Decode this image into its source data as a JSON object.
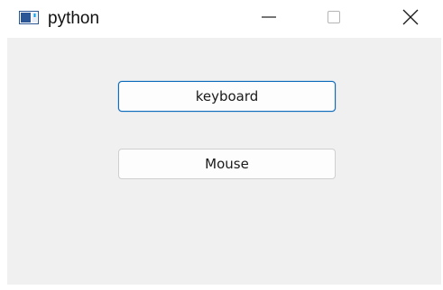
{
  "window": {
    "title": "python",
    "icon": "app-window-icon",
    "controls": {
      "minimize_icon": "minimize-icon",
      "maximize_icon": "maximize-icon",
      "close_icon": "close-icon"
    }
  },
  "buttons": {
    "keyboard_label": "keyboard",
    "mouse_label": "Mouse"
  },
  "colors": {
    "client_background": "#f0f0f0",
    "focus_border": "#0f6cbd",
    "button_border": "#cfcfcf"
  }
}
